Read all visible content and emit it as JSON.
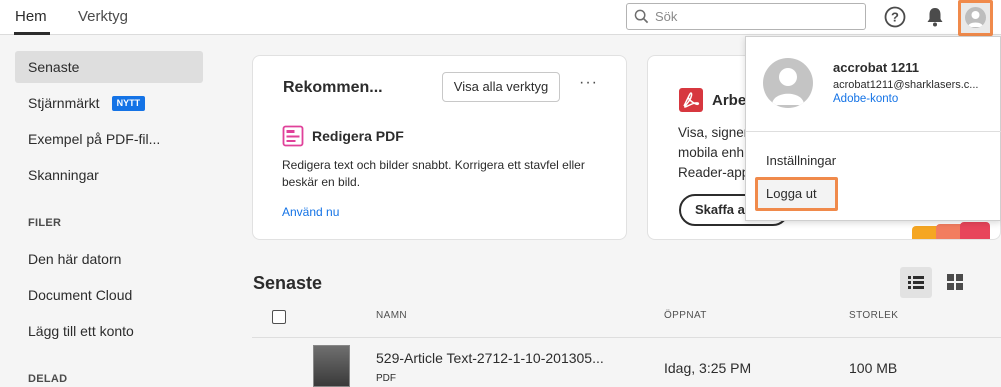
{
  "topbar": {
    "tabs": [
      {
        "label": "Hem"
      },
      {
        "label": "Verktyg"
      }
    ],
    "search": {
      "placeholder": "Sök"
    },
    "icons": {
      "help": "help-icon",
      "notifications": "bell-icon",
      "account": "avatar-icon"
    }
  },
  "sidebar": {
    "items": [
      {
        "label": "Senaste"
      },
      {
        "label": "Stjärnmärkt",
        "badge": "NYTT"
      },
      {
        "label": "Exempel på PDF-fil..."
      },
      {
        "label": "Skanningar"
      }
    ],
    "section_files": "FILER",
    "file_items": [
      {
        "label": "Den här datorn"
      },
      {
        "label": "Document Cloud"
      },
      {
        "label": "Lägg till ett konto"
      }
    ],
    "section_shared": "DELAD"
  },
  "recommended_card": {
    "title": "Rekommen...",
    "view_all_button": "Visa alla verktyg",
    "more": "···",
    "tool_name": "Redigera PDF",
    "tool_description": "Redigera text och bilder snabbt. Korrigera ett stavfel eller beskär en bild.",
    "tool_link": "Använd nu"
  },
  "promo_card": {
    "title": "Arbe",
    "description_lines": [
      "Visa, signer",
      "mobila enh",
      "Reader-app"
    ],
    "button": "Skaffa a"
  },
  "recent": {
    "title": "Senaste",
    "columns": {
      "name": "NAMN",
      "opened": "ÖPPNAT",
      "size": "STORLEK"
    },
    "files": [
      {
        "name": "529-Article Text-2712-1-10-201305...",
        "type": "PDF",
        "opened": "Idag, 3:25 PM",
        "size": "100 MB"
      }
    ]
  },
  "account_menu": {
    "name": "accrobat 1211",
    "email": "acrobat1211@sharklasers.c...",
    "account_link": "Adobe-konto",
    "settings": "Inställningar",
    "logout": "Logga ut"
  },
  "colors": {
    "accent_blue": "#1473e6",
    "highlight_orange": "#f08a4b",
    "acrobat_red": "#d7373f",
    "edit_pdf_pink": "#e0419a"
  }
}
